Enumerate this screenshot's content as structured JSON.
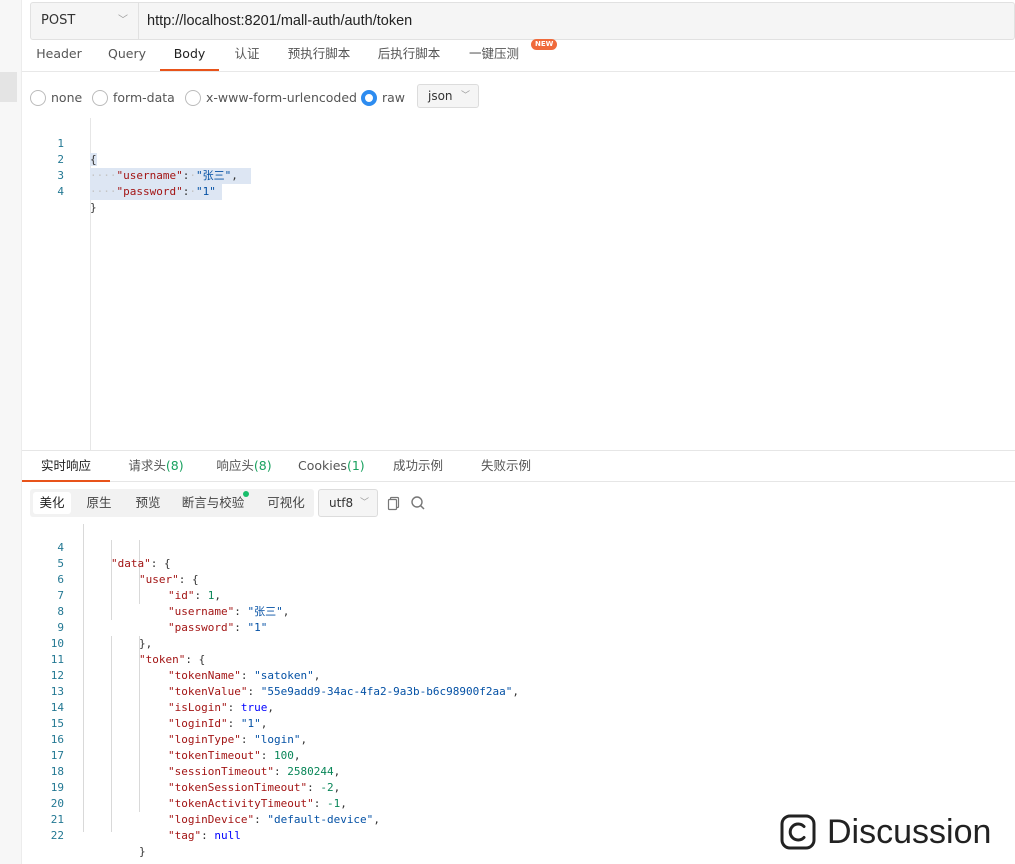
{
  "request": {
    "method": "POST",
    "url": "http://localhost:8201/mall-auth/auth/token"
  },
  "request_tabs": [
    {
      "label": "Header"
    },
    {
      "label": "Query"
    },
    {
      "label": "Body"
    },
    {
      "label": "认证"
    },
    {
      "label": "预执行脚本"
    },
    {
      "label": "后执行脚本"
    },
    {
      "label": "一键压测"
    }
  ],
  "active_request_tab": "Body",
  "new_badge": "NEW",
  "body_modes": [
    {
      "label": "none"
    },
    {
      "label": "form-data"
    },
    {
      "label": "x-www-form-urlencoded"
    },
    {
      "label": "raw"
    }
  ],
  "selected_body_mode": "raw",
  "body_format": "json",
  "request_body": {
    "lines": [
      {
        "n": "1",
        "brace": "{"
      },
      {
        "n": "2",
        "key": "\"username\"",
        "value": "\"张三\"",
        "comma": ","
      },
      {
        "n": "3",
        "key": "\"password\"",
        "value": "\"1\""
      },
      {
        "n": "4",
        "brace": "}"
      }
    ]
  },
  "response_tabs": {
    "live": "实时响应",
    "req_headers": "请求头",
    "req_headers_count": "(8)",
    "resp_headers": "响应头",
    "resp_headers_count": "(8)",
    "cookies": "Cookies",
    "cookies_count": "(1)",
    "success_example": "成功示例",
    "fail_example": "失败示例"
  },
  "response_view_modes": [
    {
      "label": "美化"
    },
    {
      "label": "原生"
    },
    {
      "label": "预览"
    },
    {
      "label": "断言与校验"
    },
    {
      "label": "可视化"
    }
  ],
  "active_view_mode": "美化",
  "encoding": "utf8",
  "response_body": {
    "lines": [
      {
        "n": "4",
        "key": "\"data\"",
        "tail": ": {"
      },
      {
        "n": "5",
        "key": "\"user\"",
        "tail": ": {"
      },
      {
        "n": "6",
        "key": "\"id\"",
        "num": "1",
        "tail": ","
      },
      {
        "n": "7",
        "key": "\"username\"",
        "str": "\"张三\"",
        "tail": ","
      },
      {
        "n": "8",
        "key": "\"password\"",
        "str": "\"1\""
      },
      {
        "n": "9",
        "brace": "},"
      },
      {
        "n": "10",
        "key": "\"token\"",
        "tail": ": {"
      },
      {
        "n": "11",
        "key": "\"tokenName\"",
        "str": "\"satoken\"",
        "tail": ","
      },
      {
        "n": "12",
        "key": "\"tokenValue\"",
        "str": "\"55e9add9-34ac-4fa2-9a3b-b6c98900f2aa\"",
        "tail": ","
      },
      {
        "n": "13",
        "key": "\"isLogin\"",
        "kw": "true",
        "tail": ","
      },
      {
        "n": "14",
        "key": "\"loginId\"",
        "str": "\"1\"",
        "tail": ","
      },
      {
        "n": "15",
        "key": "\"loginType\"",
        "str": "\"login\"",
        "tail": ","
      },
      {
        "n": "16",
        "key": "\"tokenTimeout\"",
        "num": "100",
        "tail": ","
      },
      {
        "n": "17",
        "key": "\"sessionTimeout\"",
        "num": "2580244",
        "tail": ","
      },
      {
        "n": "18",
        "key": "\"tokenSessionTimeout\"",
        "num": "-2",
        "tail": ","
      },
      {
        "n": "19",
        "key": "\"tokenActivityTimeout\"",
        "num": "-1",
        "tail": ","
      },
      {
        "n": "20",
        "key": "\"loginDevice\"",
        "str": "\"default-device\"",
        "tail": ","
      },
      {
        "n": "21",
        "key": "\"tag\"",
        "kw": "null"
      },
      {
        "n": "22",
        "brace": "}"
      }
    ]
  },
  "watermark": "Discussion",
  "colors": {
    "accent_tab_underline": "#e8531a",
    "radio_selected": "#2d8cf0",
    "count_green": "#19a15f",
    "json_key": "#a31515",
    "json_string": "#0451a5",
    "json_number": "#098658",
    "json_keyword": "#0000ff",
    "selection": "#dde6f3"
  },
  "icons": {
    "method_dropdown": "chevron-down-icon",
    "copy": "copy-icon",
    "search": "search-icon",
    "watermark": "copyright-c-icon"
  }
}
